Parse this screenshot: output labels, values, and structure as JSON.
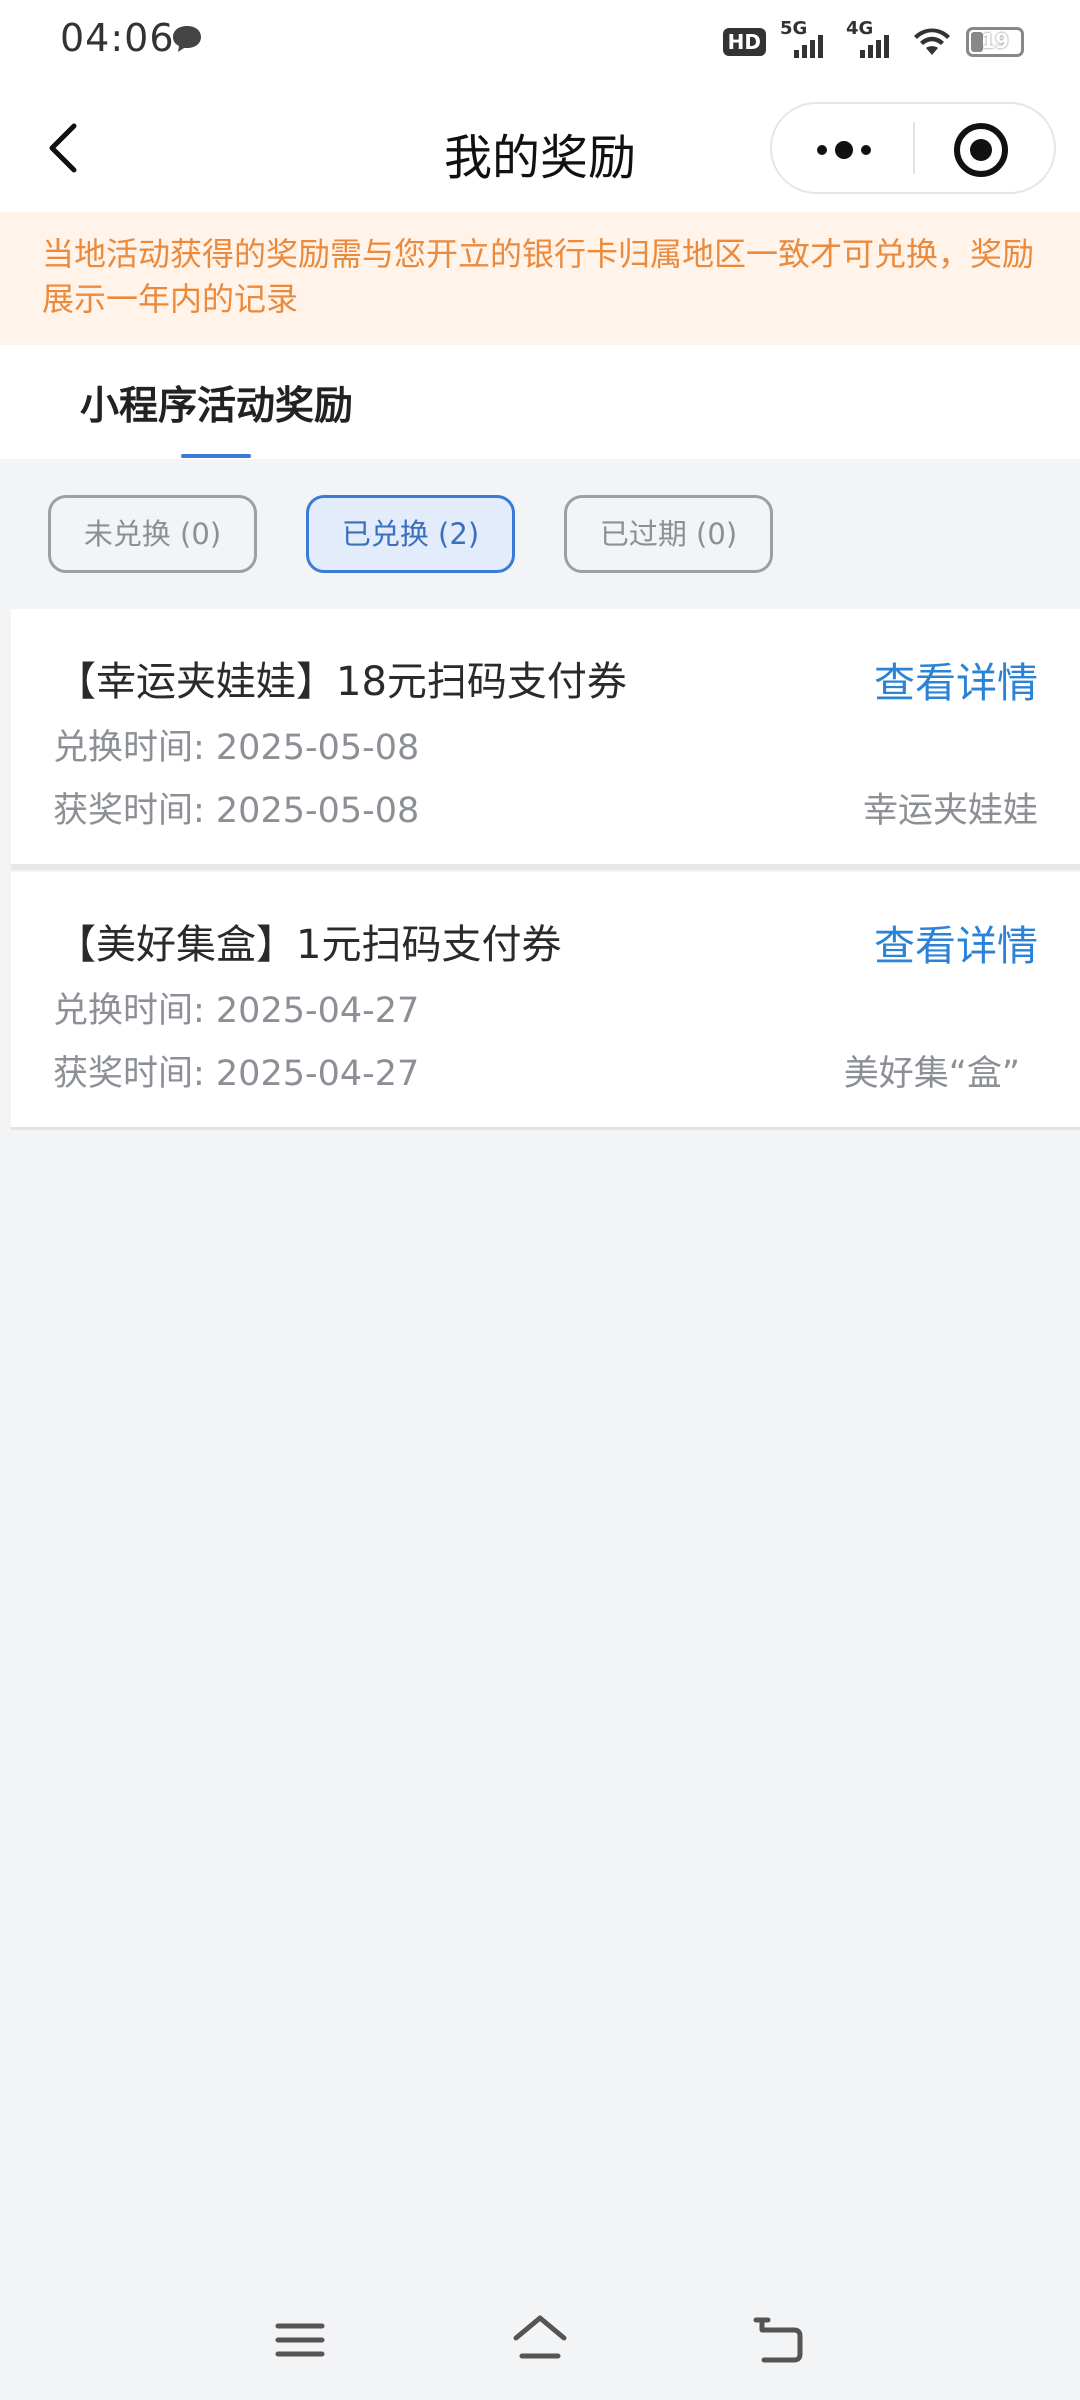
{
  "status_bar": {
    "time": "04:06",
    "hd_label": "HD",
    "network_1": "5G",
    "network_2": "4G",
    "battery": "19"
  },
  "nav": {
    "title": "我的奖励"
  },
  "notice": {
    "text": "当地活动获得的奖励需与您开立的银行卡归属地区一致才可兑换，奖励展示一年内的记录",
    "color": "#ec8a3c"
  },
  "tabs": [
    {
      "label": "小程序活动奖励",
      "active": true
    }
  ],
  "filters": [
    {
      "label": "未兑换 (0)",
      "active": false
    },
    {
      "label": "已兑换 (2)",
      "active": true
    },
    {
      "label": "已过期 (0)",
      "active": false
    }
  ],
  "rewards": [
    {
      "title": "【幸运夹娃娃】18元扫码支付券",
      "detail_link": "查看详情",
      "redeem_time": "兑换时间: 2025-05-08",
      "award_time": "获奖时间: 2025-05-08",
      "source": "幸运夹娃娃"
    },
    {
      "title": "【美好集盒】1元扫码支付券",
      "detail_link": "查看详情",
      "redeem_time": "兑换时间: 2025-04-27",
      "award_time": "获奖时间: 2025-04-27",
      "source": "美好集“盒”"
    }
  ],
  "theme": {
    "accent": "#3a7bd5",
    "link": "#2b83d6",
    "background": "#f3f4f6"
  },
  "icons": {
    "back": "chevron-left-icon",
    "more": "more-dots-icon",
    "close": "target-circle-icon",
    "menu": "menu-icon",
    "home": "home-icon",
    "return": "return-icon"
  }
}
